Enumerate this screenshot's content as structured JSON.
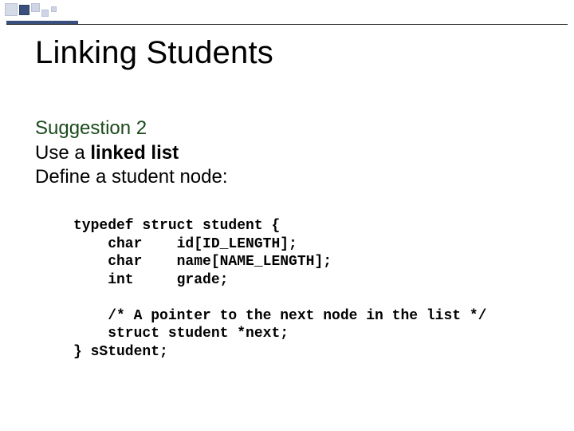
{
  "title": "Linking Students",
  "body": {
    "suggestion_label": "Suggestion 2",
    "line2_prefix": "Use a ",
    "line2_bold": "linked list",
    "line3": "Define a student node:"
  },
  "code": {
    "l1": "typedef struct student {",
    "l2": "    char    id[ID_LENGTH];",
    "l3": "    char    name[NAME_LENGTH];",
    "l4": "    int     grade;",
    "blank": "",
    "l5": "    /* A pointer to the next node in the list */",
    "l6": "    struct student *next;",
    "l7": "} sStudent;"
  }
}
